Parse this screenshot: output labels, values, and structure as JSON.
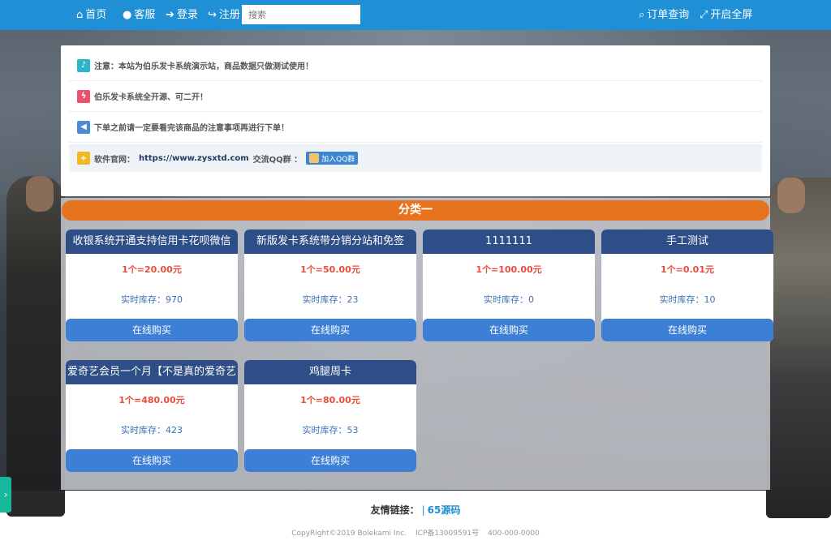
{
  "nav": {
    "home": "首页",
    "service": "客服",
    "login": "登录",
    "register": "注册",
    "search_placeholder": "搜索",
    "order_query": "订单查询",
    "fullscreen": "开启全屏"
  },
  "notices": [
    {
      "text": "注意：本站为伯乐发卡系统演示站，商品数据只做测试使用！",
      "icon": "bell-icon",
      "color": "#2bb5c9"
    },
    {
      "text": "伯乐发卡系统全开源、可二开！",
      "icon": "bolt-icon",
      "color": "#e8536b"
    },
    {
      "text": "下单之前请一定要看完该商品的注意事项再进行下单！",
      "icon": "megaphone-icon",
      "color": "#4a8bd6"
    }
  ],
  "official": {
    "label": "软件官网：",
    "url": "https://www.zysxtd.com",
    "qq_group_label": "交流QQ群 ：",
    "qq_button": "加入QQ群",
    "icon": "plus-icon",
    "color": "#f1b81f"
  },
  "category": "分类一",
  "products": [
    {
      "name": "收银系统开通支持信用卡花呗微信",
      "price": "1个=20.00元",
      "stock": "实时库存：970",
      "buy": "在线购买"
    },
    {
      "name": "新版发卡系统带分销分站和免签",
      "price": "1个=50.00元",
      "stock": "实时库存：23",
      "buy": "在线购买"
    },
    {
      "name": "1111111",
      "price": "1个=100.00元",
      "stock": "实时库存：0",
      "buy": "在线购买"
    },
    {
      "name": "手工测试",
      "price": "1个=0.01元",
      "stock": "实时库存：10",
      "buy": "在线购买"
    },
    {
      "name": "爱奇艺会员一个月【不是真的爱奇艺",
      "price": "1个=480.00元",
      "stock": "实时库存：423",
      "buy": "在线购买"
    },
    {
      "name": "鸡腿周卡",
      "price": "1个=80.00元",
      "stock": "实时库存：53",
      "buy": "在线购买"
    }
  ],
  "footer": {
    "friend_links_label": "友情链接：",
    "separator": "|",
    "friend_link": "65源码",
    "copyright": "CopyRight©2019 Bolekami Inc.",
    "icp": "ICP备13009591号",
    "phone": "400-000-0000"
  },
  "colors": {
    "topbar": "#1f8fd6",
    "category_bar": "#e8731e",
    "card_title": "#2d4e86",
    "buy_button": "#3e7fd6",
    "price": "#e84d3c"
  }
}
